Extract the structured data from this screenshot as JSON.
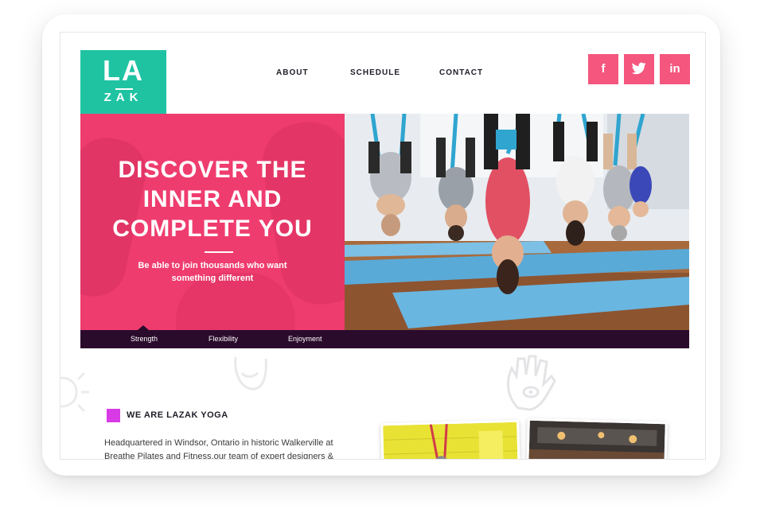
{
  "brand": {
    "logo_top": "LA",
    "logo_bottom": "ZAK"
  },
  "nav": {
    "items": [
      {
        "label": "ABOUT"
      },
      {
        "label": "SCHEDULE"
      },
      {
        "label": "CONTACT"
      }
    ]
  },
  "social": {
    "facebook_label": "f",
    "icons": [
      "facebook-icon",
      "twitter-icon",
      "linkedin-icon"
    ],
    "linkedin_label": "in"
  },
  "hero": {
    "headline_lines": [
      "DISCOVER THE",
      "INNER AND",
      "COMPLETE YOU"
    ],
    "subtext": "Be able to join thousands who want something different"
  },
  "tabs": [
    {
      "label": "Strength",
      "selected": true
    },
    {
      "label": "Flexibility",
      "selected": false
    },
    {
      "label": "Enjoyment",
      "selected": false
    }
  ],
  "section": {
    "title": "WE ARE LAZAK YOGA",
    "body": "Headquartered in Windsor, Ontario in historic Walkerville at Breathe Pilates and Fitness,our team of expert designers &"
  },
  "colors": {
    "accent_teal": "#1fc3a2",
    "accent_pink": "#ef3c6e",
    "social_pink": "#f4567d",
    "tabbar_dark": "#2b0b2c",
    "section_magenta": "#d83ae6"
  }
}
